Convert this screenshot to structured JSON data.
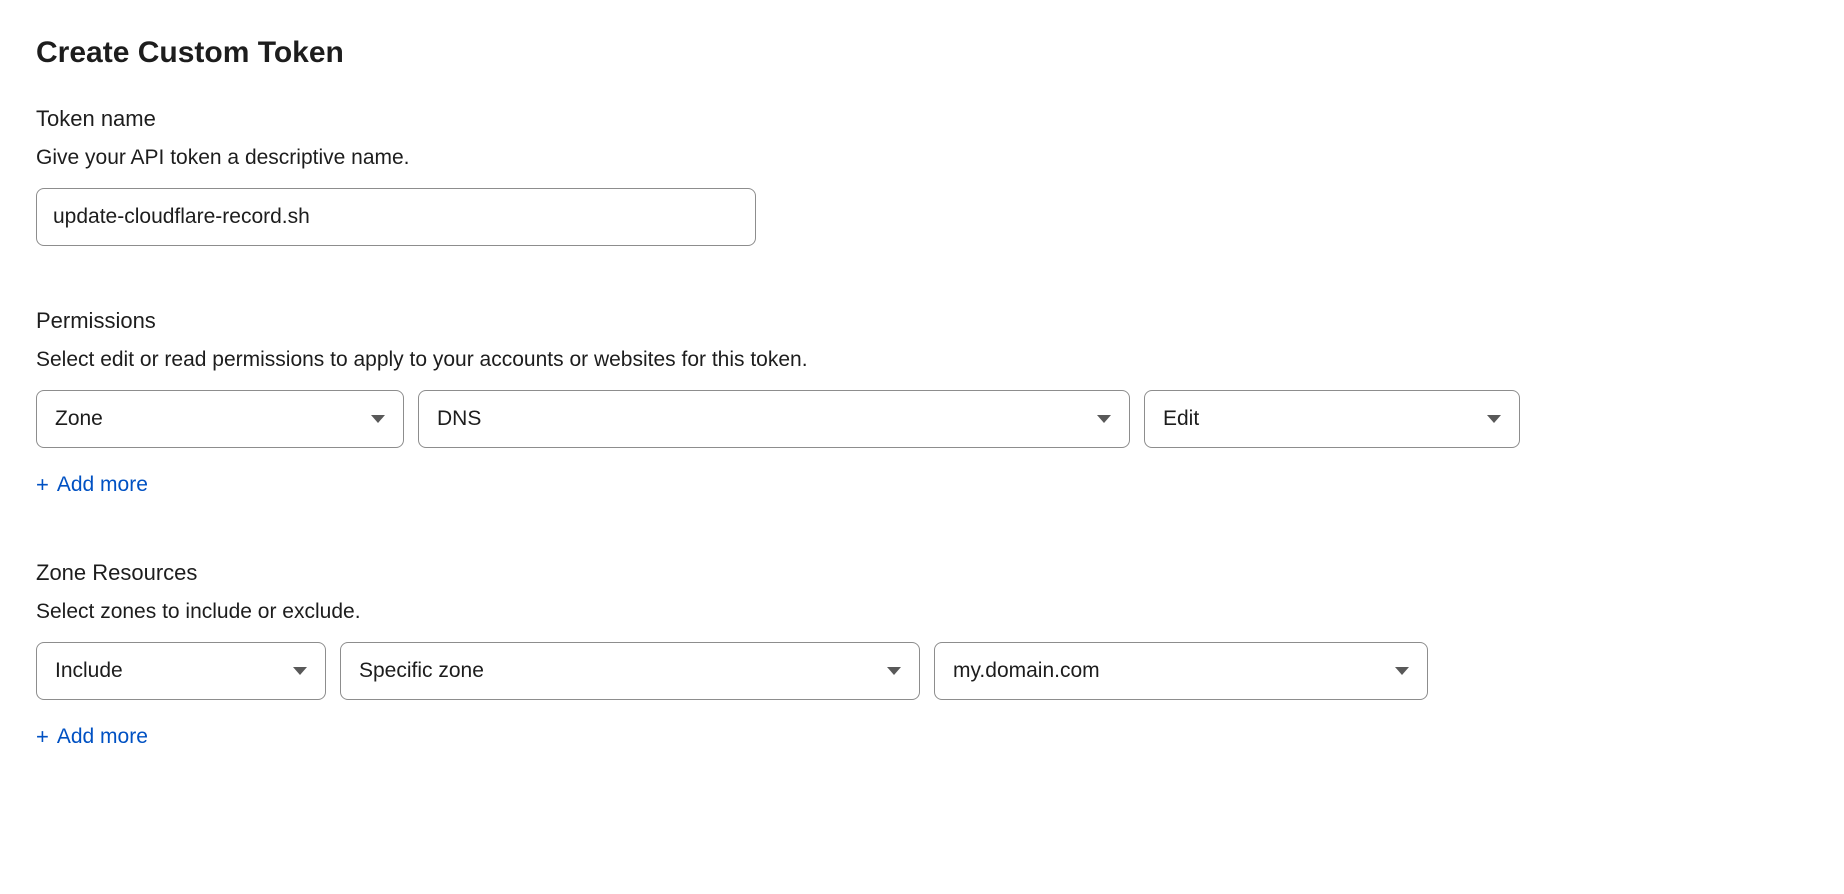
{
  "page_title": "Create Custom Token",
  "token_name": {
    "heading": "Token name",
    "description": "Give your API token a descriptive name.",
    "value": "update-cloudflare-record.sh"
  },
  "permissions": {
    "heading": "Permissions",
    "description": "Select edit or read permissions to apply to your accounts or websites for this token.",
    "rows": [
      {
        "scope": "Zone",
        "resource": "DNS",
        "level": "Edit"
      }
    ],
    "add_more_label": "Add more"
  },
  "zone_resources": {
    "heading": "Zone Resources",
    "description": "Select zones to include or exclude.",
    "rows": [
      {
        "mode": "Include",
        "type": "Specific zone",
        "zone": "my.domain.com"
      }
    ],
    "add_more_label": "Add more"
  }
}
